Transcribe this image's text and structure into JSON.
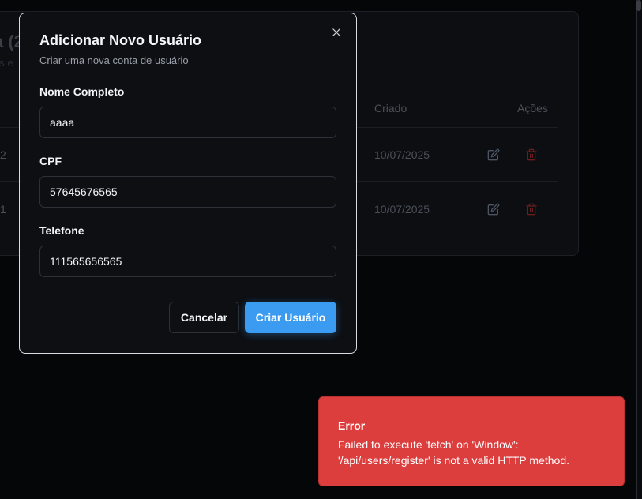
{
  "background": {
    "title_fragment": "a (2",
    "subtitle_fragment": "es e",
    "columns": {
      "created": "Criado",
      "actions": "Ações"
    },
    "rows": [
      {
        "id_fragment": "2",
        "created": "10/07/2025"
      },
      {
        "id_fragment": "1",
        "created": "10/07/2025"
      }
    ],
    "edit_icon": "edit-icon",
    "delete_icon": "trash-icon"
  },
  "modal": {
    "title": "Adicionar Novo Usuário",
    "description": "Criar uma nova conta de usuário",
    "close_icon": "close-icon",
    "fields": {
      "name": {
        "label": "Nome Completo",
        "value": "aaaa"
      },
      "cpf": {
        "label": "CPF",
        "value": "57645676565"
      },
      "phone": {
        "label": "Telefone",
        "value": "111565656565"
      }
    },
    "cancel_label": "Cancelar",
    "submit_label": "Criar Usuário"
  },
  "toast": {
    "title": "Error",
    "message": "Failed to execute 'fetch' on 'Window': '/api/users/register' is not a valid HTTP method."
  },
  "colors": {
    "primary": "#3b9bf0",
    "destructive": "#dc3d3d",
    "background": "#050608"
  }
}
